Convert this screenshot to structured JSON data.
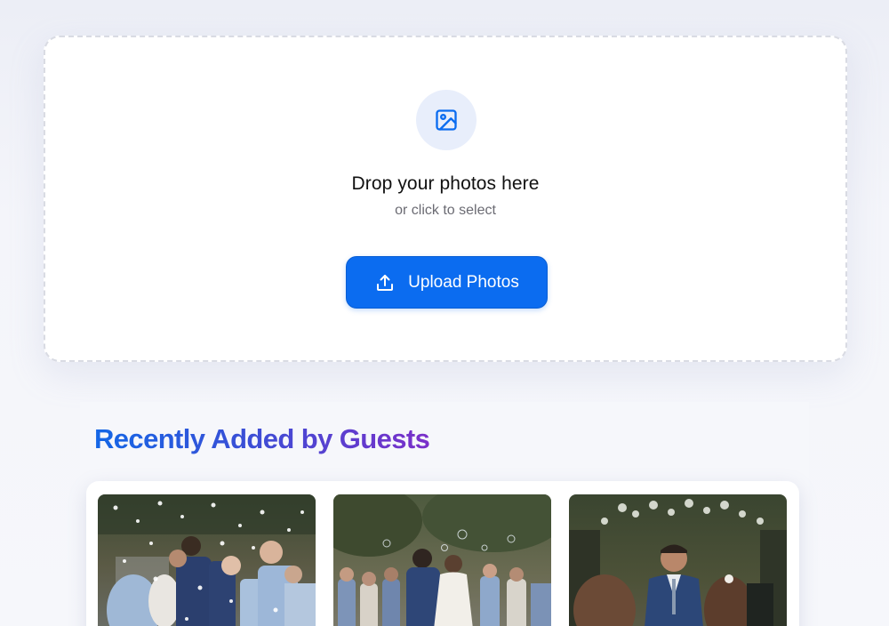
{
  "upload": {
    "icon": "image-icon",
    "title": "Drop your photos here",
    "subtitle": "or click to select",
    "button_label": "Upload Photos",
    "button_icon": "upload-icon"
  },
  "recent": {
    "title": "Recently Added by Guests",
    "photos": [
      "photo-confetti-kiss",
      "photo-bubble-exit",
      "photo-ceremony-groom"
    ]
  },
  "colors": {
    "accent": "#0b6cf0",
    "title_gradient_start": "#1467e6",
    "title_gradient_end": "#7a2fc9"
  }
}
